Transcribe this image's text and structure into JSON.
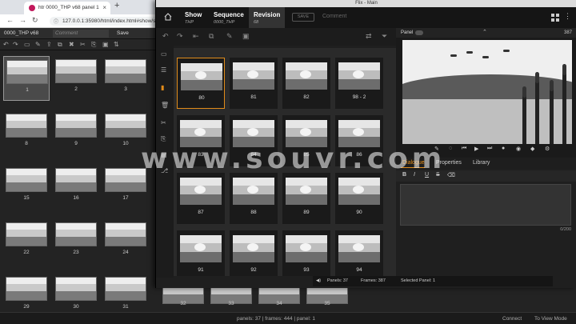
{
  "browser": {
    "tab_title": "htr 0000_THP v68 panel 1",
    "new_tab": "+",
    "url": "127.0.0.1:35980/html/index.html#show/sho",
    "project_label": "0000_THP v68",
    "comment_placeholder": "Comment",
    "save_label": "Save"
  },
  "storyboard_grid": [
    {
      "num": "1",
      "selected": true
    },
    {
      "num": "2"
    },
    {
      "num": "3"
    },
    {
      "num": "8"
    },
    {
      "num": "9"
    },
    {
      "num": "10"
    },
    {
      "num": "15"
    },
    {
      "num": "16"
    },
    {
      "num": "17"
    },
    {
      "num": "22"
    },
    {
      "num": "23"
    },
    {
      "num": "24"
    },
    {
      "num": "29"
    },
    {
      "num": "30"
    },
    {
      "num": "31"
    }
  ],
  "bottom_row": [
    "32",
    "33",
    "34",
    "35"
  ],
  "browser_status": {
    "summary": "panels: 37 | frames: 444 | panel: 1",
    "connect": "Connect",
    "view_mode": "To View Mode"
  },
  "flix": {
    "window_title": "Flix - Main",
    "breadcrumbs": [
      {
        "title": "Show",
        "value": "THP"
      },
      {
        "title": "Sequence",
        "value": "0000_THP"
      },
      {
        "title": "Revision",
        "value": "68"
      }
    ],
    "save_label": "SAVE",
    "comment_placeholder": "Comment",
    "panels": [
      {
        "num": "80",
        "selected": true
      },
      {
        "num": "81"
      },
      {
        "num": "82"
      },
      {
        "num": "98 - 2"
      },
      {
        "num": "83"
      },
      {
        "num": "84"
      },
      {
        "num": "85"
      },
      {
        "num": "86"
      },
      {
        "num": "87"
      },
      {
        "num": "88"
      },
      {
        "num": "89"
      },
      {
        "num": "90"
      },
      {
        "num": "91"
      },
      {
        "num": "92"
      },
      {
        "num": "93"
      },
      {
        "num": "94"
      }
    ],
    "status": {
      "panels": "Panels: 37",
      "frames": "Frames: 387",
      "selected": "Selected Panel: 1"
    },
    "viewer": {
      "panel_label": "Panel",
      "frame_count": "387"
    },
    "panel_tabs": [
      "Dialogue",
      "Properties",
      "Library"
    ],
    "format_buttons": [
      "B",
      "I",
      "U",
      "S"
    ],
    "char_count": "0/200"
  },
  "watermark": "www.souvr.com"
}
